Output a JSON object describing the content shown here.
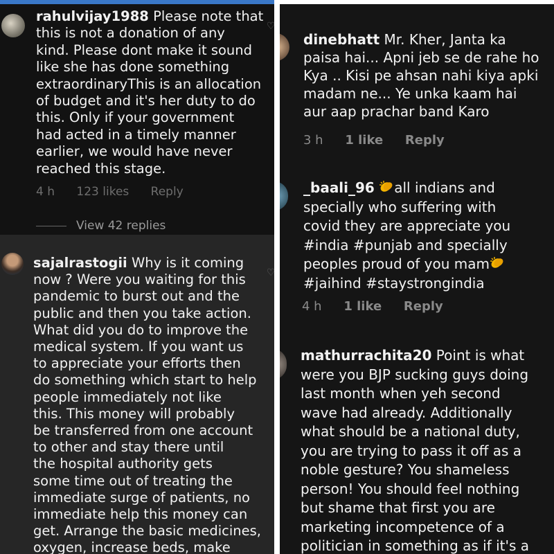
{
  "left": {
    "comments": [
      {
        "username": "rahulvijay1988",
        "lines": [
          "Please note that",
          "this is not a donation of any",
          "kind. Please dont make it sound",
          "like she has done something",
          "extraordinaryThis is an allocation",
          "of budget and it's her duty to do",
          "this. Only if your government",
          "had acted in a timely manner",
          "earlier, we would have never",
          "reached this stage."
        ],
        "time": "4 h",
        "likes": "123 likes",
        "reply": "Reply",
        "view_replies": "View 42 replies"
      },
      {
        "username": "sajalrastogii",
        "lines": [
          "Why is it coming",
          "now ? Were you waiting for this",
          "pandemic to burst out and the",
          "public and then you take action.",
          "What did you do to improve the",
          "medical system. If you want us",
          "to appreciate your efforts then",
          "do something which start to help",
          "people immediately not like",
          "this. This money will probably",
          "be transferred from one account",
          "to other and stay there until",
          "the hospital authority gets",
          "some time out of treating the",
          "immediate surge of patients, no",
          "immediate help this money can",
          "get. Arrange the basic medicines,",
          "oxygen, increase beds, make"
        ]
      }
    ]
  },
  "right": {
    "comments": [
      {
        "username": "dinebhatt",
        "lines": [
          "Mr. Kher,  Janta ka",
          "paisa hai... Apni jeb se de rahe ho",
          "Kya .. Kisi pe ahsan nahi kiya apki",
          "madam ne... Ye unka kaam hai",
          "aur aap prachar band Karo"
        ],
        "time": "3 h",
        "likes": "1 like",
        "reply": "Reply"
      },
      {
        "username": "_baali_96",
        "lines": [
          "all indians and",
          "specially who suffering with",
          "covid they are appreciate you",
          "#india #punjab and specially",
          "peoples proud of you mam",
          "#jaihind #staystrongindia"
        ],
        "time": "4 h",
        "likes": "1 like",
        "reply": "Reply"
      },
      {
        "username": "mathurrachita20",
        "lines": [
          "Point is what",
          "were you BJP sucking guys doing",
          "last month when yeh second",
          "wave had already. Additionally",
          "what should be a national duty,",
          "you are trying to pass it off as a",
          "noble gesture? You shameless",
          "person! You should feel nothing",
          "but shame that first you are",
          "marketing incompetence of a",
          "politician in something as if it's a"
        ]
      }
    ]
  },
  "icons": {
    "heart": "heart-outline-icon",
    "clap": "clapping-hands-emoji"
  },
  "colors": {
    "background_dark": "#121212",
    "lower_section": "#262626",
    "text": "#f2f2f2",
    "meta": "#8a8a8a",
    "clap": "#f4b400"
  }
}
